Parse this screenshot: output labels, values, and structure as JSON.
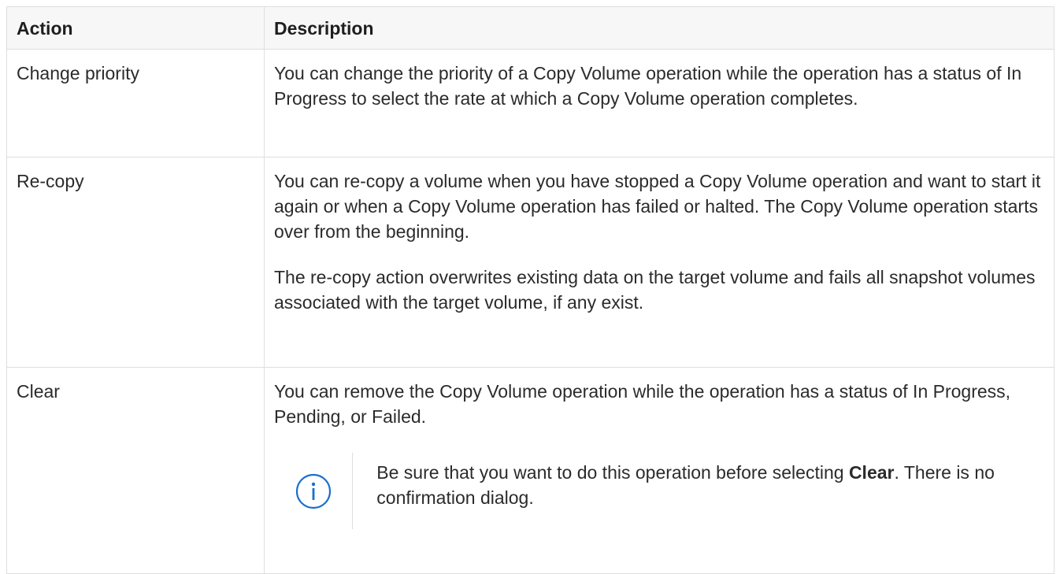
{
  "table": {
    "headers": {
      "action": "Action",
      "description": "Description"
    },
    "rows": [
      {
        "action": "Change priority",
        "paragraphs": [
          "You can change the priority of a Copy Volume operation while the operation has a status of In Progress to select the rate at which a Copy Volume operation completes."
        ]
      },
      {
        "action": "Re-copy",
        "paragraphs": [
          "You can re-copy a volume when you have stopped a Copy Volume operation and want to start it again or when a Copy Volume operation has failed or halted. The Copy Volume operation starts over from the beginning.",
          "The re-copy action overwrites existing data on the target volume and fails all snapshot volumes associated with the target volume, if any exist."
        ]
      },
      {
        "action": "Clear",
        "paragraphs": [
          "You can remove the Copy Volume operation while the operation has a status of In Progress, Pending, or Failed."
        ],
        "note": {
          "icon": "info-icon",
          "text_before": "Be sure that you want to do this operation before selecting ",
          "bold": "Clear",
          "text_after": ". There is no confirmation dialog."
        }
      }
    ]
  },
  "colors": {
    "accent": "#1a6fc9",
    "border": "#dedede",
    "header_bg": "#f7f7f7",
    "text": "#2b2b2b"
  }
}
